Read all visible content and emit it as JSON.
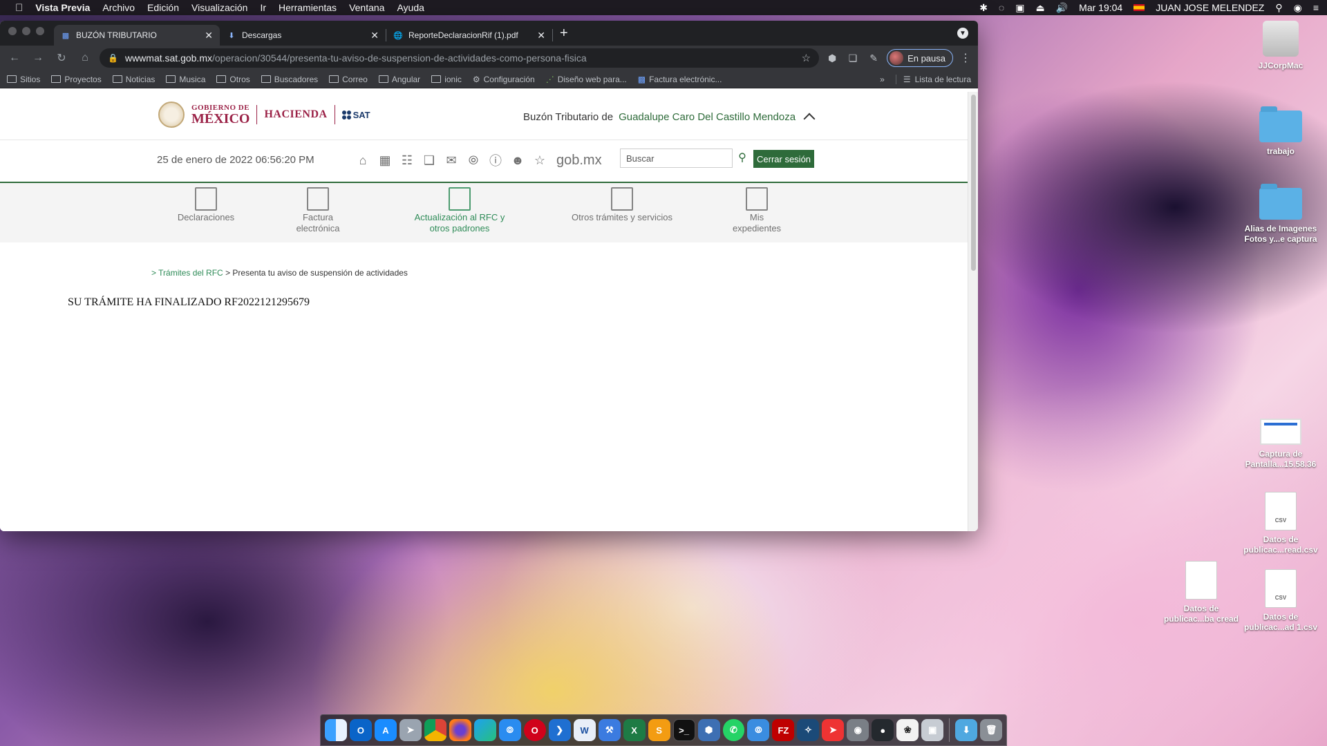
{
  "menubar": {
    "app": "Vista Previa",
    "items": [
      "Archivo",
      "Edición",
      "Visualización",
      "Ir",
      "Herramientas",
      "Ventana",
      "Ayuda"
    ],
    "clock": "Mar 19:04",
    "user": "JUAN JOSE MELENDEZ"
  },
  "tabs": [
    {
      "title": "BUZÓN TRIBUTARIO",
      "icon": "sat-favicon-icon",
      "active": true
    },
    {
      "title": "Descargas",
      "icon": "download-icon",
      "active": false
    },
    {
      "title": "ReporteDeclaracionRif (1).pdf",
      "icon": "globe-icon",
      "active": false
    }
  ],
  "address": {
    "host": "wwwmat.sat.gob.mx",
    "path": "/operacion/30544/presenta-tu-aviso-de-suspension-de-actividades-como-persona-fisica"
  },
  "profile": {
    "label": "En pausa"
  },
  "bookmarks": [
    "Sitios",
    "Proyectos",
    "Noticias",
    "Musica",
    "Otros",
    "Buscadores",
    "Correo",
    "Angular",
    "ionic",
    "Configuración",
    "Diseño web para...",
    "Factura electrónic..."
  ],
  "reading_list": "Lista de lectura",
  "gov": {
    "gob_line1": "GOBIERNO DE",
    "gob_line2": "MÉXICO",
    "hacienda": "HACIENDA",
    "sat": "SAT",
    "buzon_label": "Buzón Tributario de",
    "user_name": "Guadalupe Caro Del Castillo Mendoza"
  },
  "utility": {
    "date": "25 de enero de 2022 06:56:20 PM",
    "gobmx": "gob.mx",
    "search_placeholder": "Buscar",
    "logout": "Cerrar sesión"
  },
  "main_nav": [
    {
      "label": "Declaraciones",
      "active": false
    },
    {
      "label": "Factura\nelectrónica",
      "active": false
    },
    {
      "label": "Actualización al RFC y\notros padrones",
      "active": true
    },
    {
      "label": "Otros trámites y servicios",
      "active": false
    },
    {
      "label": "Mis\nexpedientes",
      "active": false
    }
  ],
  "breadcrumb": {
    "prefix": ">",
    "link": "Trámites del RFC",
    "sep": ">",
    "current": "Presenta tu aviso de suspensión de actividades"
  },
  "status_message": "SU TRÁMITE HA FINALIZADO RF2022121295679",
  "desktop": [
    {
      "label": "JJCorpMac",
      "kind": "disk"
    },
    {
      "label": "trabajo",
      "kind": "folder"
    },
    {
      "label": "Alias de Imagenes Fotos y...e captura",
      "kind": "folder"
    },
    {
      "label": "Captura de Pantalla...15.58.36",
      "kind": "screenshot"
    },
    {
      "label": "Datos de publicac...read.csv",
      "kind": "csv"
    },
    {
      "label": "Datos de publicac...ba cread",
      "kind": "doc"
    },
    {
      "label": "Datos de publicac...ad 1.csv",
      "kind": "csv"
    }
  ],
  "dock_apps": [
    "finder",
    "outlook",
    "app-store",
    "launchpad",
    "chrome",
    "firefox",
    "edge",
    "safari",
    "opera",
    "vscode",
    "word",
    "xcode",
    "excel",
    "sublime",
    "terminal",
    "virtualbox",
    "whatsapp",
    "safari-alt",
    "filezilla",
    "mysql-workbench",
    "git",
    "disk-utility",
    "github",
    "ladybug",
    "preview"
  ],
  "colors": {
    "sat_green": "#2e6b3a",
    "gob_maroon": "#9b2247",
    "active_nav": "#2e8b57"
  }
}
